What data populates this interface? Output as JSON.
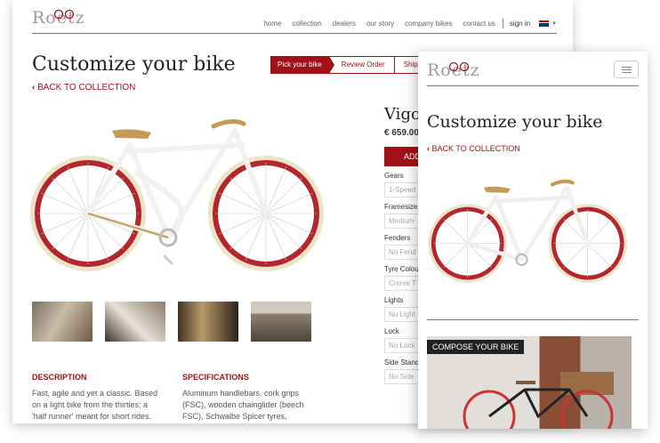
{
  "brand": {
    "logo_text": "Roetz"
  },
  "desktop": {
    "nav": {
      "items": [
        "home",
        "collection",
        "dealers",
        "our story",
        "company bikes",
        "contact us"
      ],
      "signin": "sign in"
    },
    "page_title": "Customize your bike",
    "back_link": "BACK TO COLLECTION",
    "steps": [
      "Pick your bike",
      "Review Order",
      "Shippin"
    ],
    "product": {
      "name": "Vigo",
      "price": "€ 659.00",
      "add_label": "ADD"
    },
    "options": [
      {
        "label": "Gears",
        "value": "1-Speed"
      },
      {
        "label": "Framesize",
        "value": "Medium"
      },
      {
        "label": "Fenders",
        "value": "No Fend"
      },
      {
        "label": "Tyre Colou",
        "value": "Creme T"
      },
      {
        "label": "Lights",
        "value": "No Light"
      },
      {
        "label": "Lock",
        "value": "No Lock"
      },
      {
        "label": "Side Stand",
        "value": "No Side"
      }
    ],
    "description": {
      "heading": "DESCRIPTION",
      "lines": [
        "Fast, agile and yet a classic. Based",
        "on a light bike from the thirties; a",
        "'half runner' meant for short rides."
      ]
    },
    "specifications": {
      "heading": "SPECIFICATIONS",
      "lines": [
        "Aluminum handlebars, cork grips",
        "(FSC), wooden chainglider (beech",
        "FSC), Schwalbe Spicer tyres,"
      ]
    }
  },
  "mobile": {
    "page_title": "Customize your bike",
    "back_link": "BACK TO COLLECTION",
    "compose_label": "COMPOSE YOUR BIKE"
  },
  "colors": {
    "accent": "#a01218",
    "tyre": "#b3262d",
    "frame": "#f4f4f2",
    "saddle": "#c49a55"
  }
}
